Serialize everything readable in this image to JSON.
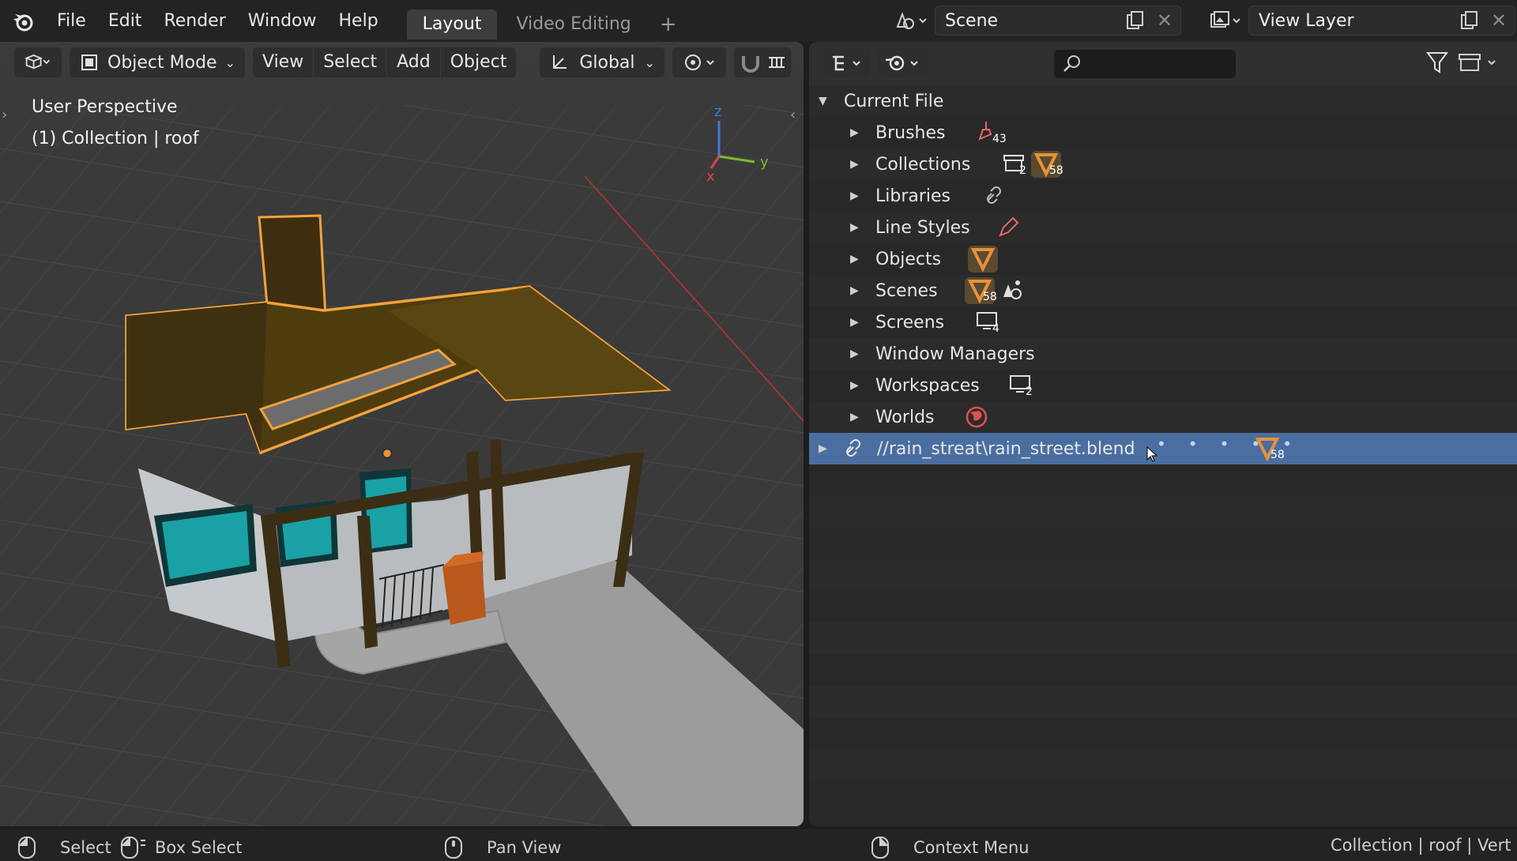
{
  "topbar": {
    "menu": [
      "File",
      "Edit",
      "Render",
      "Window",
      "Help"
    ],
    "workspace_tabs": [
      "Layout",
      "Video Editing"
    ],
    "active_tab": "Layout",
    "scene_name": "Scene",
    "view_layer_name": "View Layer"
  },
  "viewport": {
    "mode": "Object Mode",
    "menus": [
      "View",
      "Select",
      "Add",
      "Object"
    ],
    "transform_orientation": "Global",
    "perspective_label": "User Perspective",
    "collection_label": "(1) Collection | roof",
    "gizmo_axes": {
      "z": "z",
      "y": "y",
      "x": "x"
    }
  },
  "outliner": {
    "root_label": "Current File",
    "items": [
      {
        "label": "Brushes",
        "count": "43",
        "icon": "brush-icon"
      },
      {
        "label": "Collections",
        "count": "2",
        "count2": "58",
        "icon": "collection-icon"
      },
      {
        "label": "Libraries",
        "icon": "link-icon"
      },
      {
        "label": "Line Styles",
        "icon": "linestyle-icon"
      },
      {
        "label": "Objects",
        "icon": "object-icon"
      },
      {
        "label": "Scenes",
        "count": "58",
        "icon": "scene-icon"
      },
      {
        "label": "Screens",
        "count": "4",
        "icon": "screen-icon"
      },
      {
        "label": "Window Managers",
        "icon": ""
      },
      {
        "label": "Workspaces",
        "count": "2",
        "icon": "workspace-icon"
      },
      {
        "label": "Worlds",
        "icon": "world-icon"
      }
    ],
    "library_row": {
      "label": "//rain_streat\\rain_street.blend",
      "count": "58"
    }
  },
  "statusbar": {
    "select": "Select",
    "box_select": "Box Select",
    "pan_view": "Pan View",
    "context_menu": "Context Menu",
    "info": "Collection | roof | Vert"
  },
  "colors": {
    "accent_orange": "#e8913a",
    "selected_row": "#4a6ea0",
    "axis_red": "#d9434f",
    "axis_green": "#7dbb2d",
    "axis_blue": "#3d7ad6"
  }
}
